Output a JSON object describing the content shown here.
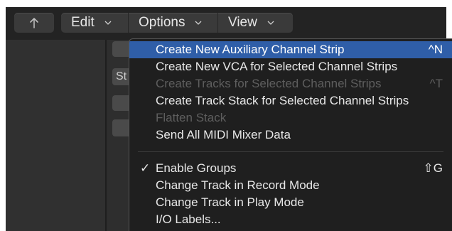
{
  "toolbar": {
    "back_icon": "back-arrow-icon",
    "edit_label": "Edit",
    "options_label": "Options",
    "view_label": "View"
  },
  "left": {
    "strip_label": "St"
  },
  "menu": {
    "items": [
      {
        "label": "Create New Auxiliary Channel Strip",
        "shortcut": "^N",
        "enabled": true,
        "selected": true
      },
      {
        "label": "Create New VCA for Selected Channel Strips",
        "shortcut": "",
        "enabled": true
      },
      {
        "label": "Create Tracks for Selected Channel Strips",
        "shortcut": "^T",
        "enabled": false
      },
      {
        "label": "Create Track Stack for Selected Channel Strips",
        "shortcut": "",
        "enabled": true
      },
      {
        "label": "Flatten Stack",
        "shortcut": "",
        "enabled": false
      },
      {
        "label": "Send All MIDI Mixer Data",
        "shortcut": "",
        "enabled": true
      },
      {
        "label": "Enable Groups",
        "shortcut": "⇧G",
        "enabled": true,
        "checked": true,
        "check": "✓"
      },
      {
        "label": "Change Track in Record Mode",
        "shortcut": "",
        "enabled": true
      },
      {
        "label": "Change Track in Play Mode",
        "shortcut": "",
        "enabled": true
      },
      {
        "label": "I/O Labels...",
        "shortcut": "",
        "enabled": true
      }
    ]
  },
  "colors": {
    "selection": "#2f5ea8",
    "menu_bg": "#1f1f1f",
    "disabled_text": "#5e5e5e"
  }
}
